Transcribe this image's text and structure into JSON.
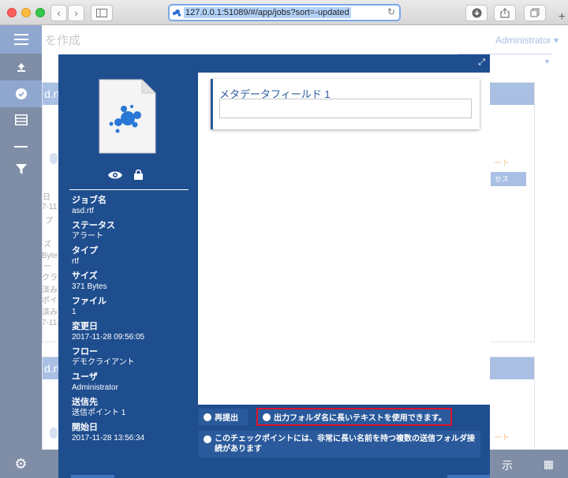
{
  "browser": {
    "url": "127.0.0.1:51089/#/app/jobs?sort=-updated",
    "back_icon": "chevron-left-icon",
    "forward_icon": "chevron-right-icon",
    "sidebar_toggle_icon": "sidebar-icon",
    "download_icon": "download-icon",
    "share_icon": "share-icon",
    "tabs_icon": "tabs-icon",
    "new_tab": "+"
  },
  "app": {
    "header_title": "を作成",
    "user": "Administrator",
    "footer_label": "示",
    "bg_cards": [
      {
        "title": "d.rtf"
      },
      {
        "title": "d.rtf"
      }
    ],
    "bg_fragments": {
      "c1": "日",
      "c2": "7-11-",
      "c3": "プ",
      "c4": "ズ",
      "c5": "Byte",
      "c6": "ー",
      "c7": "クラ",
      "c8": "済み",
      "c9": "ポイ",
      "c10": "済み",
      "c11": "7-11-",
      "orange1": "ート",
      "orange2": "ート",
      "btn1": "セス"
    }
  },
  "sidebar": {
    "icons": [
      "menu-icon",
      "upload-icon",
      "check-circle-icon",
      "list-icon",
      "minus-icon",
      "filter-icon",
      "gear-icon"
    ]
  },
  "modal": {
    "expand_icon": "expand-icon",
    "file_type": "rtf",
    "info": [
      {
        "label": "ジョブ名",
        "value": "asd.rtf"
      },
      {
        "label": "ステータス",
        "value": "アラート"
      },
      {
        "label": "タイプ",
        "value": "rtf"
      },
      {
        "label": "サイズ",
        "value": "371 Bytes"
      },
      {
        "label": "ファイル",
        "value": "1"
      },
      {
        "label": "変更日",
        "value": "2017-11-28 09:56:05"
      },
      {
        "label": "フロー",
        "value": "デモクライアント"
      },
      {
        "label": "ユーザ",
        "value": "Administrator"
      },
      {
        "label": "送信先",
        "value": "送信ポイント 1"
      },
      {
        "label": "開始日",
        "value": "2017-11-28 13:56:34"
      }
    ],
    "metadata_field": {
      "label": "メタデータフィールド 1",
      "value": ""
    },
    "checkpoints": [
      {
        "label": "再提出",
        "highlighted": false
      },
      {
        "label": "出力フォルダ名に長いテキストを使用できます。",
        "highlighted": true
      },
      {
        "label": "このチェックポイントには、非常に長い名前を持つ複数の送信フォルダ接続があります",
        "highlighted": false
      }
    ]
  },
  "colors": {
    "modal_bg": "#1f4e8f",
    "accent": "#2a5a9c",
    "highlight_border": "#e0112a",
    "sidebar": "#7f8da6"
  }
}
